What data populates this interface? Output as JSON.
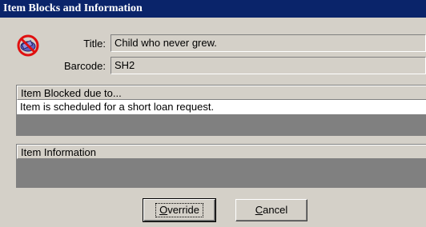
{
  "window": {
    "title": "Item Blocks and Information"
  },
  "form": {
    "title_label": "Title:",
    "title_value": "Child who never grew.",
    "barcode_label": "Barcode:",
    "barcode_value": "SH2"
  },
  "blocked_panel": {
    "header": "Item Blocked due to...",
    "rows": [
      "Item is scheduled for a short loan request."
    ]
  },
  "info_panel": {
    "header": "Item Information",
    "rows": []
  },
  "buttons": {
    "override_accel": "O",
    "override_rest": "verride",
    "cancel_accel": "C",
    "cancel_rest": "ancel"
  },
  "icons": {
    "status": "blocked-item-icon"
  }
}
